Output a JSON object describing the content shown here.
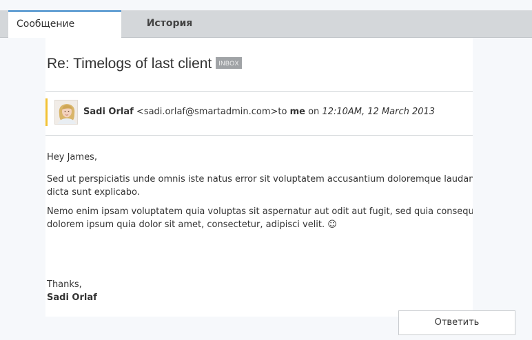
{
  "tabs": {
    "message_label": "Сообщение",
    "history_label": "История"
  },
  "message": {
    "subject": "Re: Timelogs of last client",
    "folder_badge": "INBOX",
    "sender_name": "Sadi Orlaf",
    "sender_email": "<sadi.orlaf@smartadmin.com>",
    "to_word": "to",
    "recipient": "me",
    "on_word": "on",
    "date": "12:10AM, 12 March 2013",
    "greeting": "Hey James,",
    "paragraph_1_line_1": "Sed ut perspiciatis unde omnis iste natus error sit voluptatem accusantium doloremque laudantium, totam rem aperiam",
    "paragraph_1_line_2": "dicta sunt explicabo.",
    "paragraph_2_line_1": "Nemo enim ipsam voluptatem quia voluptas sit aspernatur aut odit aut fugit, sed quia consequuntur magni dolores eos",
    "paragraph_2_line_2": "dolorem ipsum quia dolor sit amet, consectetur, adipisci velit. ☺",
    "closing": "Thanks,",
    "signature": "Sadi Orlaf"
  },
  "actions": {
    "reply_label": "Ответить"
  },
  "colors": {
    "active_tab_accent": "#3a87c8",
    "sender_accent": "#f2c234",
    "badge_bg": "#a0a3a6"
  }
}
